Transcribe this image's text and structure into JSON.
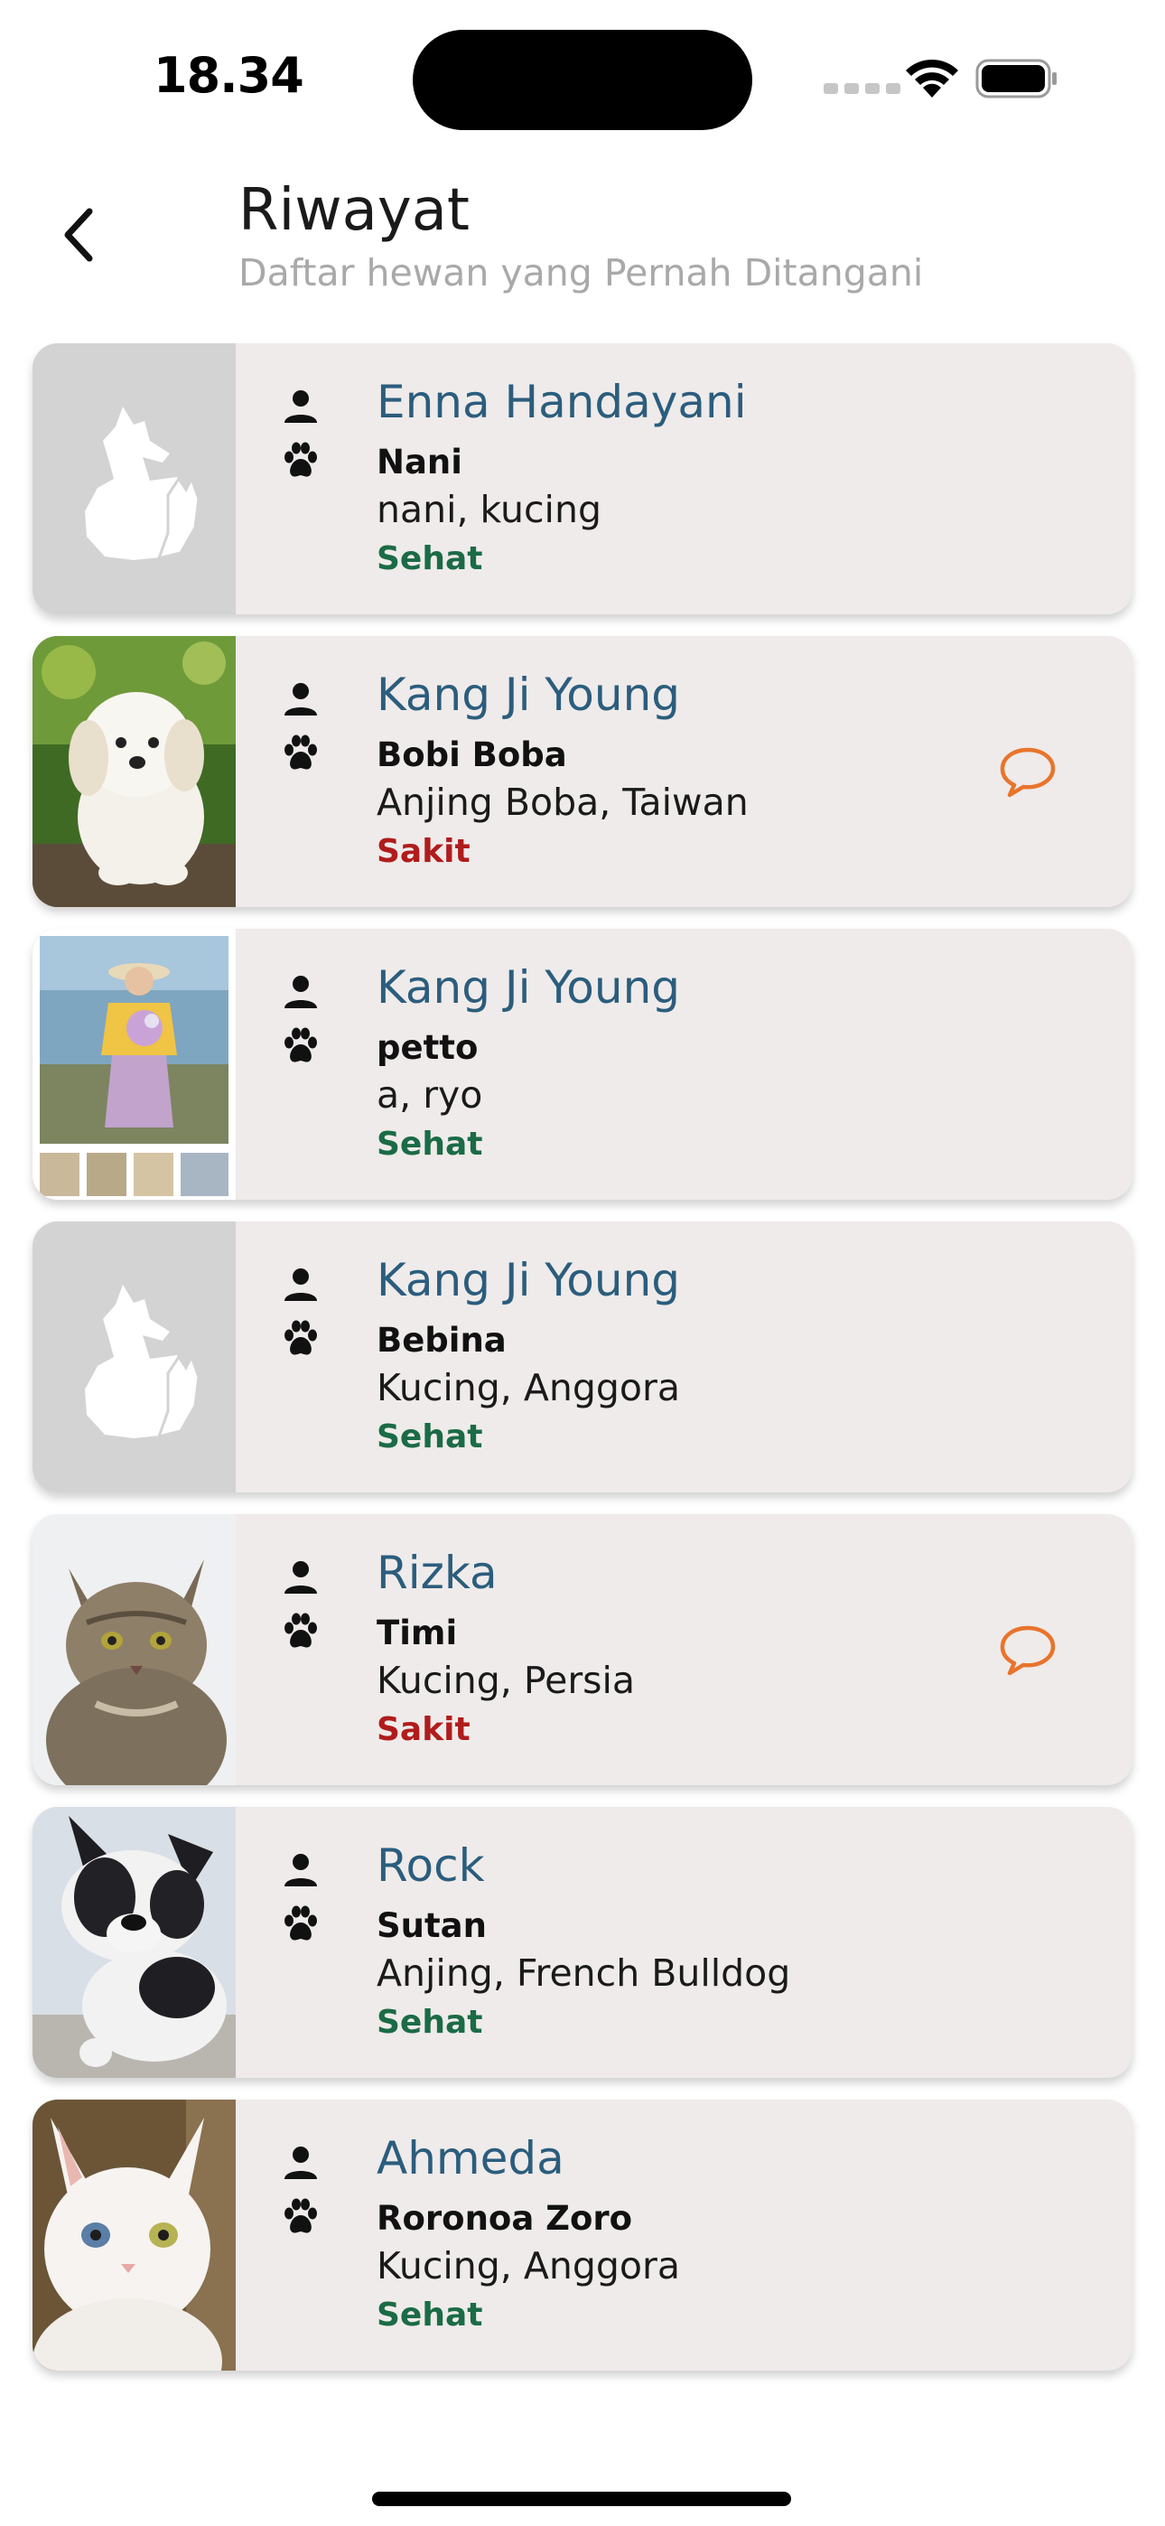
{
  "status_bar": {
    "time": "18.34"
  },
  "header": {
    "title": "Riwayat",
    "subtitle": "Daftar hewan yang Pernah Ditangani"
  },
  "colors": {
    "owner_text": "#2b5d7d",
    "healthy": "#1b6b46",
    "sick": "#b01c1c",
    "chat_icon": "#e8742c",
    "card_bg": "#efebea"
  },
  "records": [
    {
      "owner": "Enna Handayani",
      "pet_name": "Nani",
      "species_breed": "nani, kucing",
      "status": "Sehat",
      "photo": "placeholder-pet-icon",
      "has_chat": false
    },
    {
      "owner": "Kang Ji Young",
      "pet_name": "Bobi Boba",
      "species_breed": "Anjing Boba, Taiwan",
      "status": "Sakit",
      "photo": "puppy-photo",
      "has_chat": true
    },
    {
      "owner": "Kang Ji Young",
      "pet_name": "petto",
      "species_breed": "a, ryo",
      "status": "Sehat",
      "photo": "woman-photo",
      "has_chat": false
    },
    {
      "owner": "Kang Ji Young",
      "pet_name": "Bebina",
      "species_breed": "Kucing, Anggora",
      "status": "Sehat",
      "photo": "placeholder-pet-icon",
      "has_chat": false
    },
    {
      "owner": "Rizka",
      "pet_name": "Timi",
      "species_breed": "Kucing, Persia",
      "status": "Sakit",
      "photo": "tabby-cat-photo",
      "has_chat": true
    },
    {
      "owner": "Rock",
      "pet_name": "Sutan",
      "species_breed": "Anjing, French Bulldog",
      "status": "Sehat",
      "photo": "bulldog-photo",
      "has_chat": false
    },
    {
      "owner": "Ahmeda",
      "pet_name": "Roronoa Zoro",
      "species_breed": "Kucing, Anggora",
      "status": "Sehat",
      "photo": "white-cat-photo",
      "has_chat": false
    }
  ]
}
